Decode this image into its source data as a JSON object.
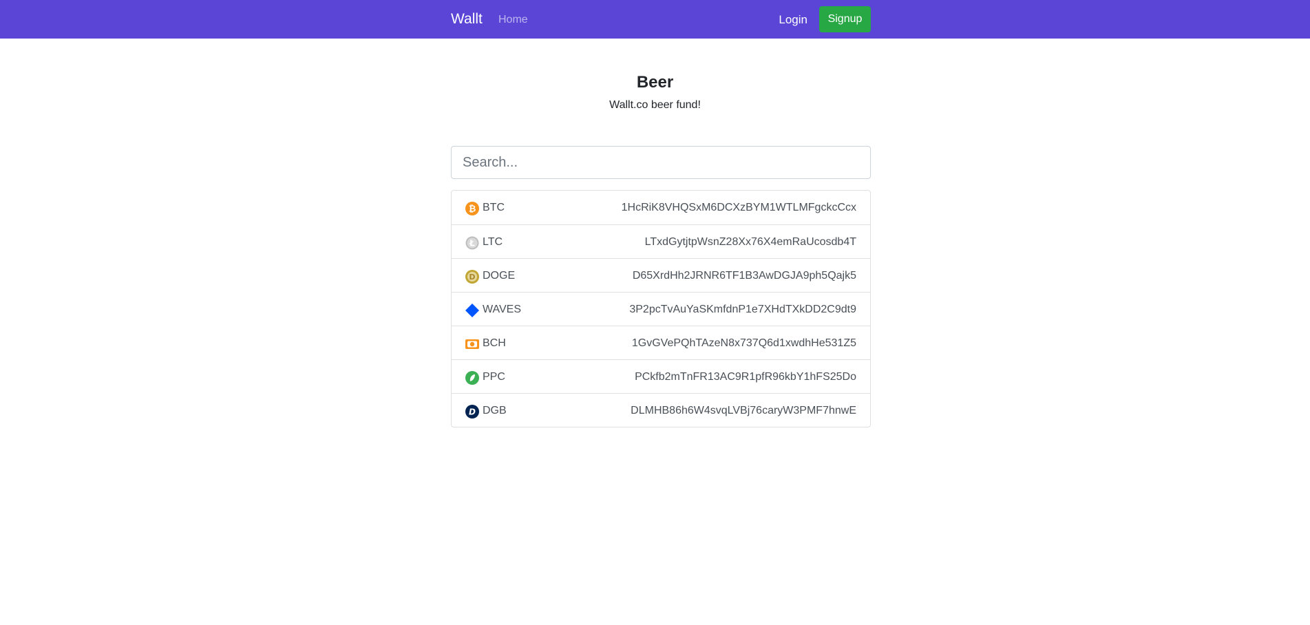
{
  "nav": {
    "brand": "Wallt",
    "home": "Home",
    "login": "Login",
    "signup": "Signup"
  },
  "page": {
    "title": "Beer",
    "subtitle": "Wallt.co beer fund!"
  },
  "search": {
    "placeholder": "Search..."
  },
  "wallets": [
    {
      "symbol": "BTC",
      "address": "1HcRiK8VHQSxM6DCXzBYM1WTLMFgckcCcx",
      "icon": "bitcoin-icon"
    },
    {
      "symbol": "LTC",
      "address": "LTxdGytjtpWsnZ28Xx76X4emRaUcosdb4T",
      "icon": "litecoin-icon"
    },
    {
      "symbol": "DOGE",
      "address": "D65XrdHh2JRNR6TF1B3AwDGJA9ph5Qajk5",
      "icon": "dogecoin-icon"
    },
    {
      "symbol": "WAVES",
      "address": "3P2pcTvAuYaSKmfdnP1e7XHdTXkDD2C9dt9",
      "icon": "waves-icon"
    },
    {
      "symbol": "BCH",
      "address": "1GvGVePQhTAzeN8x737Q6d1xwdhHe531Z5",
      "icon": "bitcoin-cash-icon"
    },
    {
      "symbol": "PPC",
      "address": "PCkfb2mTnFR13AC9R1pfR96kbY1hFS25Do",
      "icon": "peercoin-icon"
    },
    {
      "symbol": "DGB",
      "address": "DLMHB86h6W4svqLVBj76caryW3PMF7hnwE",
      "icon": "digibyte-icon"
    }
  ],
  "colors": {
    "navbar": "#5a45d6",
    "signup": "#28a745"
  }
}
